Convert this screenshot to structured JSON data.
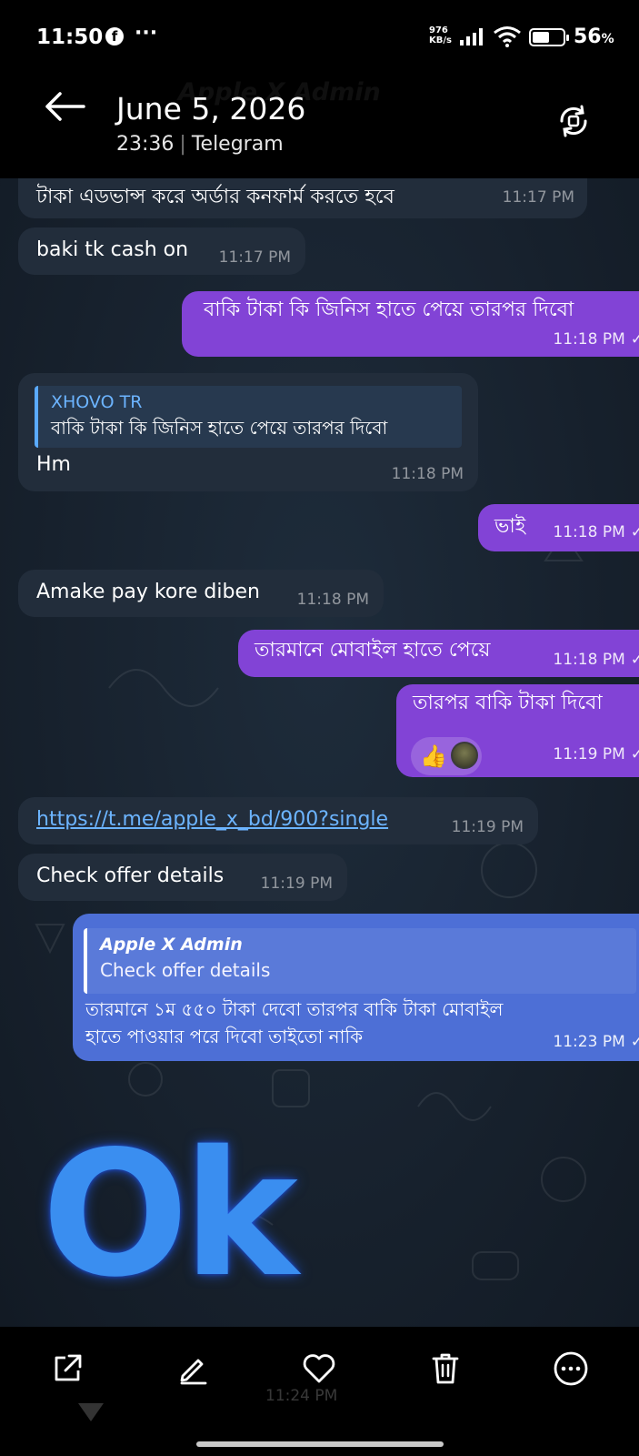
{
  "status_bar": {
    "time": "11:50",
    "more": "···",
    "net_speed_value": "976",
    "net_speed_unit": "KB/s",
    "battery_percent": "56",
    "battery_unit": "%",
    "battery_level": 0.56
  },
  "header": {
    "title": "June 5, 2026",
    "time": "23:36",
    "source": "Telegram",
    "ghost_chat_name": "Apple X Admin"
  },
  "messages": [
    {
      "dir": "in",
      "text": "টাকা এডভান্স করে অর্ডার কনফার্ম করতে হবে",
      "time": "11:17 PM"
    },
    {
      "dir": "in",
      "text": "baki tk cash on",
      "time": "11:17 PM"
    },
    {
      "dir": "out",
      "text": "বাকি টাকা কি জিনিস হাতে পেয়ে তারপর দিবো",
      "time": "11:18 PM"
    },
    {
      "dir": "in",
      "reply_name": "XHOVO TR",
      "reply_text": "বাকি টাকা কি জিনিস হাতে পেয়ে তারপর দিবো",
      "text": "Hm",
      "time": "11:18 PM"
    },
    {
      "dir": "out",
      "text": "ভাই",
      "time": "11:18 PM"
    },
    {
      "dir": "in",
      "text": "Amake pay kore diben",
      "time": "11:18 PM"
    },
    {
      "dir": "out",
      "text": "তারমানে মোবাইল হাতে পেয়ে",
      "time": "11:18 PM"
    },
    {
      "dir": "out",
      "text": "তারপর বাকি টাকা দিবো",
      "reaction": "👍",
      "time": "11:19 PM"
    },
    {
      "dir": "in",
      "text": "https://t.me/apple_x_bd/900?single",
      "time": "11:19 PM"
    },
    {
      "dir": "in",
      "text": "Check offer details",
      "time": "11:19 PM"
    },
    {
      "dir": "out",
      "reply_name": "Apple X Admin",
      "reply_text": "Check offer details",
      "line1": "তারমানে ১ম ৫৫০ টাকা দেবো তারপর বাকি টাকা মোবাইল",
      "line2": "হাতে পাওয়ার পরে দিবো তাইতো নাকি",
      "time": "11:23 PM"
    }
  ],
  "sticker_text": "Ok",
  "under_time": "11:24 PM",
  "toolbar": {
    "share": "share-icon",
    "edit": "edit-icon",
    "favorite": "heart-icon",
    "delete": "trash-icon",
    "more": "more-icon"
  },
  "colors": {
    "outgoing_bubble": "#8243d6",
    "incoming_bubble": "#222d3b",
    "reply_bubble": "#4d6fd6",
    "link": "#6cb4ff",
    "sticker": "#3a8ef0"
  }
}
